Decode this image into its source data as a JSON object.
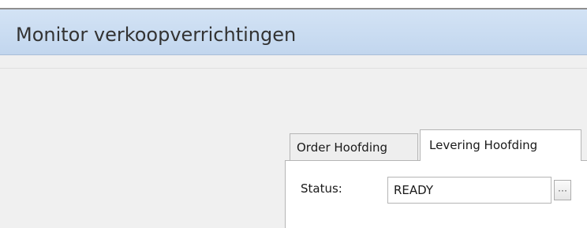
{
  "window": {
    "title": "Monitor verkoopverrichtingen"
  },
  "tabs": [
    {
      "label": "Order Hoofding",
      "active": false
    },
    {
      "label": "Levering Hoofding",
      "active": true
    }
  ],
  "form": {
    "status_label": "Status:",
    "status_value": "READY",
    "browse_button_label": "···"
  },
  "colors": {
    "title_bar": "#c7daf0",
    "window_background": "#f0f0f0",
    "panel_background": "#ffffff"
  }
}
